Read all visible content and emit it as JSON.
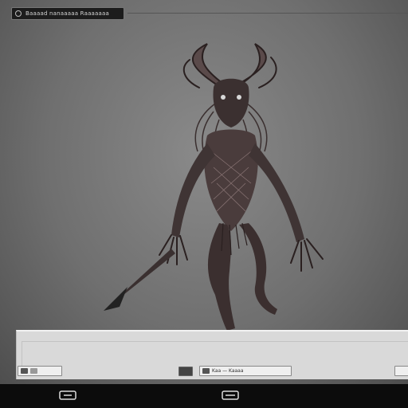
{
  "window": {
    "title_tab_text": "Baaaad nanaaaaa Raaaaaaa"
  },
  "taskbar": {
    "left_pill_text": "",
    "center_pill_text": "Kaa — Kaaaa",
    "right_pill_text": ""
  },
  "colors": {
    "desktop_bg": "#767676",
    "panel_bg": "#d9d9d9",
    "navbar_bg": "#0c0c0c"
  },
  "icons": {
    "nav_left": "recent-apps-icon",
    "nav_center": "home-icon"
  }
}
